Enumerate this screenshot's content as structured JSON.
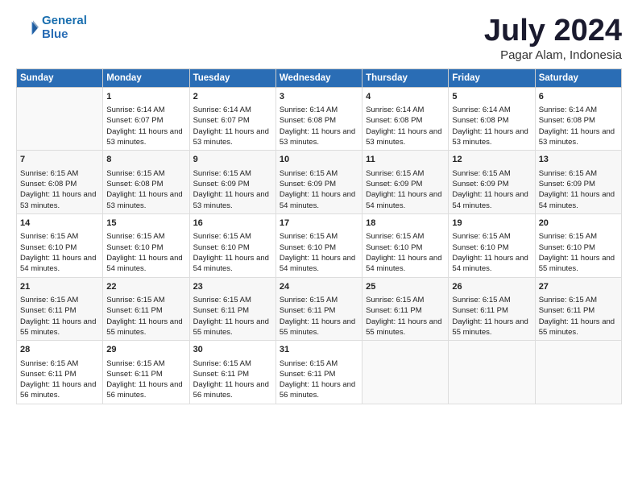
{
  "logo": {
    "line1": "General",
    "line2": "Blue"
  },
  "title": "July 2024",
  "subtitle": "Pagar Alam, Indonesia",
  "days_header": [
    "Sunday",
    "Monday",
    "Tuesday",
    "Wednesday",
    "Thursday",
    "Friday",
    "Saturday"
  ],
  "weeks": [
    {
      "cells": [
        {
          "empty": true
        },
        {
          "day": 1,
          "sunrise": "6:14 AM",
          "sunset": "6:07 PM",
          "daylight": "11 hours and 53 minutes."
        },
        {
          "day": 2,
          "sunrise": "6:14 AM",
          "sunset": "6:07 PM",
          "daylight": "11 hours and 53 minutes."
        },
        {
          "day": 3,
          "sunrise": "6:14 AM",
          "sunset": "6:08 PM",
          "daylight": "11 hours and 53 minutes."
        },
        {
          "day": 4,
          "sunrise": "6:14 AM",
          "sunset": "6:08 PM",
          "daylight": "11 hours and 53 minutes."
        },
        {
          "day": 5,
          "sunrise": "6:14 AM",
          "sunset": "6:08 PM",
          "daylight": "11 hours and 53 minutes."
        },
        {
          "day": 6,
          "sunrise": "6:14 AM",
          "sunset": "6:08 PM",
          "daylight": "11 hours and 53 minutes."
        }
      ]
    },
    {
      "cells": [
        {
          "day": 7,
          "sunrise": "6:15 AM",
          "sunset": "6:08 PM",
          "daylight": "11 hours and 53 minutes."
        },
        {
          "day": 8,
          "sunrise": "6:15 AM",
          "sunset": "6:08 PM",
          "daylight": "11 hours and 53 minutes."
        },
        {
          "day": 9,
          "sunrise": "6:15 AM",
          "sunset": "6:09 PM",
          "daylight": "11 hours and 53 minutes."
        },
        {
          "day": 10,
          "sunrise": "6:15 AM",
          "sunset": "6:09 PM",
          "daylight": "11 hours and 54 minutes."
        },
        {
          "day": 11,
          "sunrise": "6:15 AM",
          "sunset": "6:09 PM",
          "daylight": "11 hours and 54 minutes."
        },
        {
          "day": 12,
          "sunrise": "6:15 AM",
          "sunset": "6:09 PM",
          "daylight": "11 hours and 54 minutes."
        },
        {
          "day": 13,
          "sunrise": "6:15 AM",
          "sunset": "6:09 PM",
          "daylight": "11 hours and 54 minutes."
        }
      ]
    },
    {
      "cells": [
        {
          "day": 14,
          "sunrise": "6:15 AM",
          "sunset": "6:10 PM",
          "daylight": "11 hours and 54 minutes."
        },
        {
          "day": 15,
          "sunrise": "6:15 AM",
          "sunset": "6:10 PM",
          "daylight": "11 hours and 54 minutes."
        },
        {
          "day": 16,
          "sunrise": "6:15 AM",
          "sunset": "6:10 PM",
          "daylight": "11 hours and 54 minutes."
        },
        {
          "day": 17,
          "sunrise": "6:15 AM",
          "sunset": "6:10 PM",
          "daylight": "11 hours and 54 minutes."
        },
        {
          "day": 18,
          "sunrise": "6:15 AM",
          "sunset": "6:10 PM",
          "daylight": "11 hours and 54 minutes."
        },
        {
          "day": 19,
          "sunrise": "6:15 AM",
          "sunset": "6:10 PM",
          "daylight": "11 hours and 54 minutes."
        },
        {
          "day": 20,
          "sunrise": "6:15 AM",
          "sunset": "6:10 PM",
          "daylight": "11 hours and 55 minutes."
        }
      ]
    },
    {
      "cells": [
        {
          "day": 21,
          "sunrise": "6:15 AM",
          "sunset": "6:11 PM",
          "daylight": "11 hours and 55 minutes."
        },
        {
          "day": 22,
          "sunrise": "6:15 AM",
          "sunset": "6:11 PM",
          "daylight": "11 hours and 55 minutes."
        },
        {
          "day": 23,
          "sunrise": "6:15 AM",
          "sunset": "6:11 PM",
          "daylight": "11 hours and 55 minutes."
        },
        {
          "day": 24,
          "sunrise": "6:15 AM",
          "sunset": "6:11 PM",
          "daylight": "11 hours and 55 minutes."
        },
        {
          "day": 25,
          "sunrise": "6:15 AM",
          "sunset": "6:11 PM",
          "daylight": "11 hours and 55 minutes."
        },
        {
          "day": 26,
          "sunrise": "6:15 AM",
          "sunset": "6:11 PM",
          "daylight": "11 hours and 55 minutes."
        },
        {
          "day": 27,
          "sunrise": "6:15 AM",
          "sunset": "6:11 PM",
          "daylight": "11 hours and 55 minutes."
        }
      ]
    },
    {
      "cells": [
        {
          "day": 28,
          "sunrise": "6:15 AM",
          "sunset": "6:11 PM",
          "daylight": "11 hours and 56 minutes."
        },
        {
          "day": 29,
          "sunrise": "6:15 AM",
          "sunset": "6:11 PM",
          "daylight": "11 hours and 56 minutes."
        },
        {
          "day": 30,
          "sunrise": "6:15 AM",
          "sunset": "6:11 PM",
          "daylight": "11 hours and 56 minutes."
        },
        {
          "day": 31,
          "sunrise": "6:15 AM",
          "sunset": "6:11 PM",
          "daylight": "11 hours and 56 minutes."
        },
        {
          "empty": true
        },
        {
          "empty": true
        },
        {
          "empty": true
        }
      ]
    }
  ]
}
